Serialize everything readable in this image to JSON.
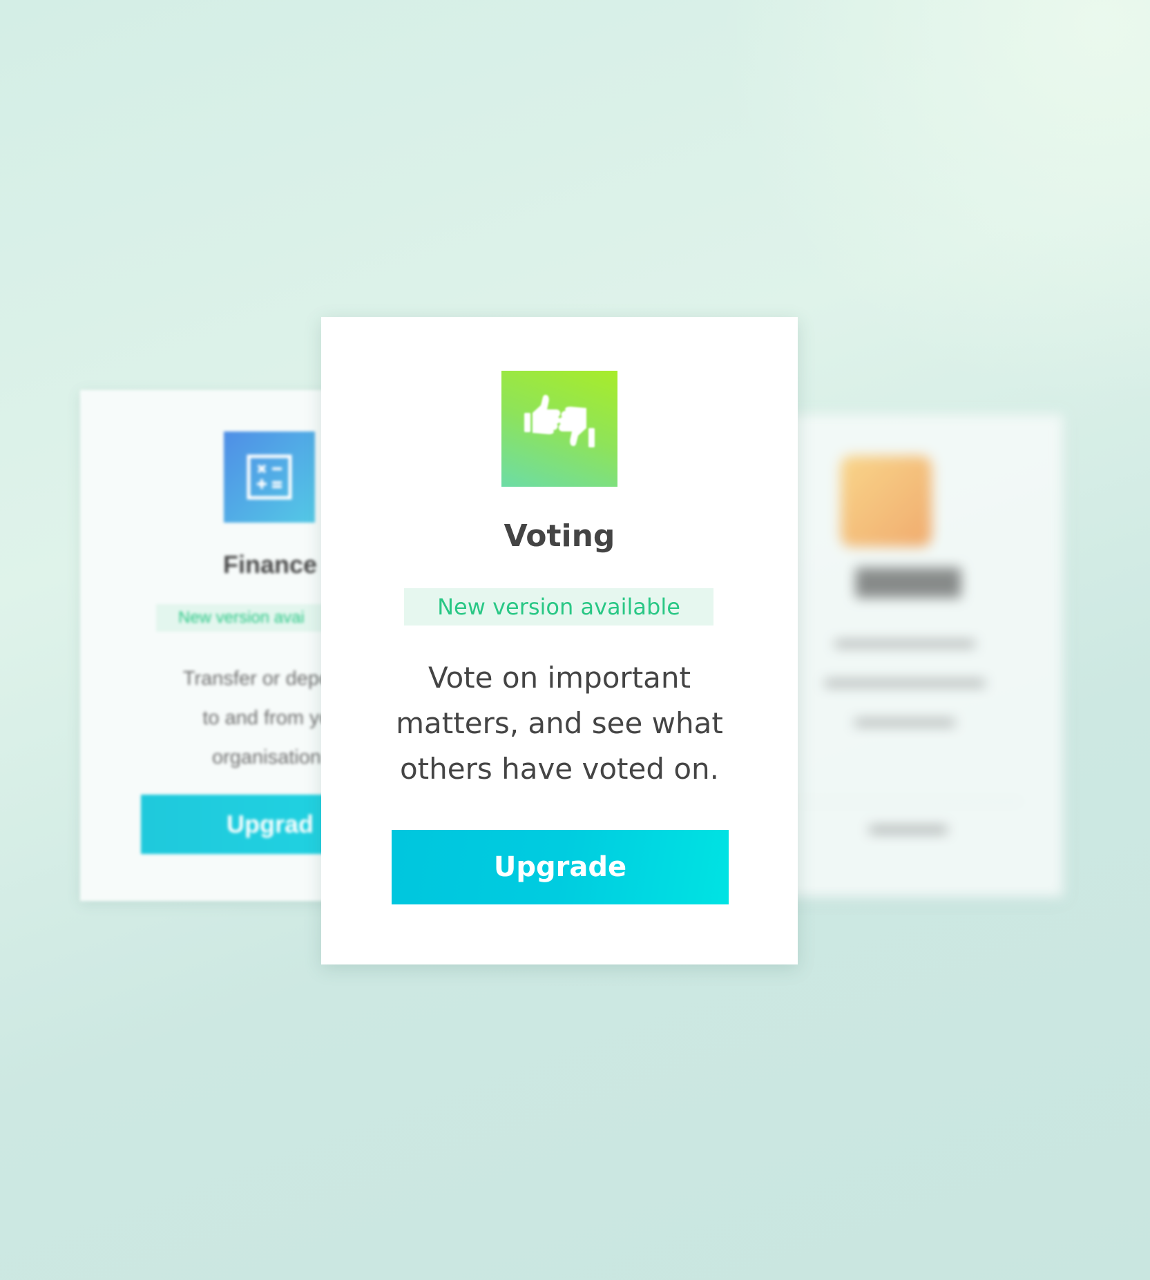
{
  "cards": {
    "left": {
      "icon": "calculator-icon",
      "title": "Finance",
      "badge": "New version avai",
      "description": "Transfer or deposit\nto and from yo\norganisation",
      "button_label": "Upgrad"
    },
    "main": {
      "icon": "thumbs-up-down-icon",
      "title": "Voting",
      "badge": "New version available",
      "description": "Vote on important matters, and see what others have voted on.",
      "button_label": "Upgrade"
    },
    "right": {
      "icon": "app-icon"
    }
  },
  "colors": {
    "badge_text": "#29c785",
    "badge_bg": "#e6f7ef",
    "button_gradient_start": "#00c6de",
    "button_gradient_end": "#00e3e3",
    "voting_icon_top": "#a8ec2a",
    "voting_icon_bottom": "#6cdca6",
    "finance_icon": "#4f8ee6",
    "right_icon": "#f6a05a"
  }
}
